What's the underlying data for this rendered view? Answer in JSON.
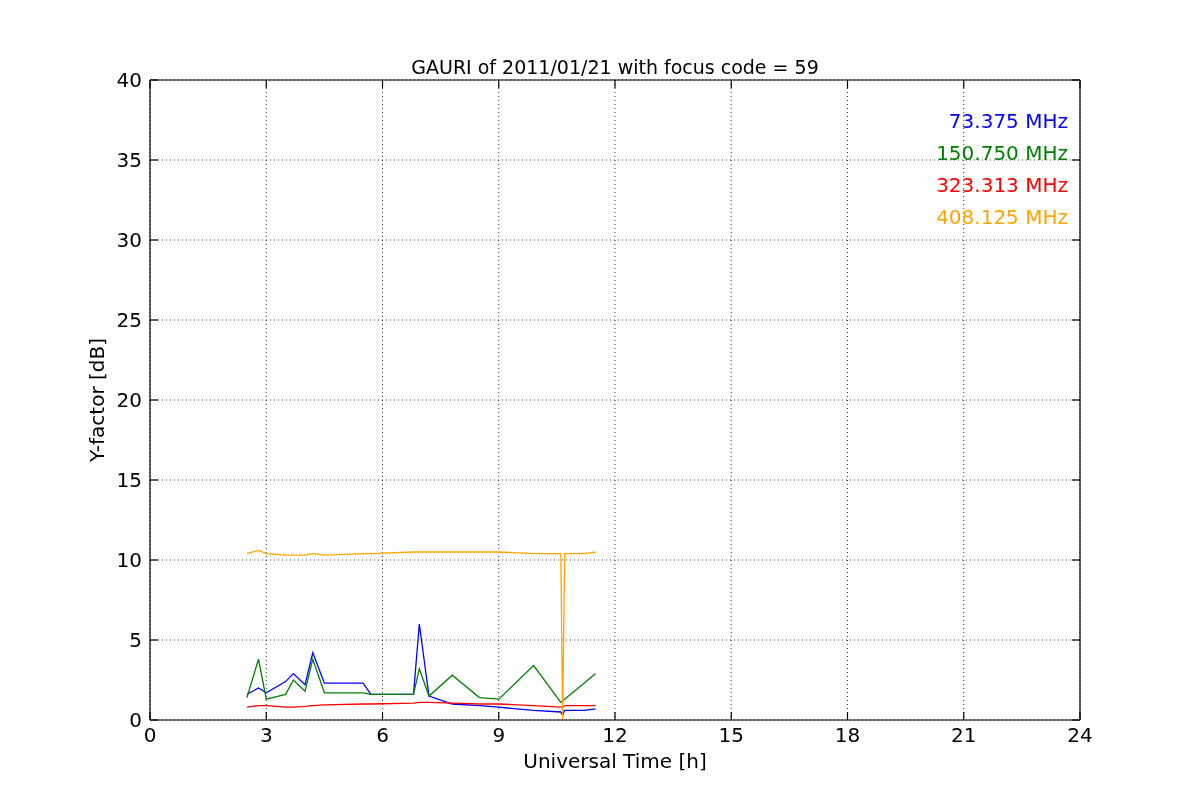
{
  "chart_data": {
    "type": "line",
    "title": "GAURI of 2011/01/21 with focus code = 59",
    "xlabel": "Universal Time [h]",
    "ylabel": "Y-factor [dB]",
    "x": [
      2.5,
      2.8,
      3,
      3.5,
      3.7,
      4,
      4.2,
      4.5,
      5.5,
      5.7,
      6.8,
      6.95,
      7.2,
      7.8,
      8.5,
      9,
      9.9,
      10.6,
      10.65,
      10.7,
      11.2,
      11.5
    ],
    "series": [
      {
        "name": "73.375 MHz",
        "color": "#0000ff",
        "values": [
          1.6,
          2.0,
          1.7,
          2.4,
          2.9,
          2.2,
          4.2,
          2.3,
          2.3,
          1.6,
          1.6,
          6.0,
          1.5,
          1.0,
          0.9,
          0.8,
          0.6,
          0.5,
          0.3,
          0.6,
          0.6,
          0.7
        ]
      },
      {
        "name": "150.750 MHz",
        "color": "#008000",
        "values": [
          1.4,
          3.8,
          1.3,
          1.6,
          2.5,
          1.8,
          3.8,
          1.7,
          1.7,
          1.6,
          1.6,
          3.2,
          1.5,
          2.8,
          1.4,
          1.3,
          3.4,
          1.1,
          1.2,
          1.3,
          2.3,
          2.9
        ]
      },
      {
        "name": "323.313 MHz",
        "color": "#ff0000",
        "values": [
          0.8,
          0.9,
          0.9,
          0.8,
          0.8,
          0.85,
          0.9,
          0.95,
          1.0,
          1.0,
          1.05,
          1.1,
          1.1,
          1.05,
          1.0,
          1.0,
          0.9,
          0.8,
          0.8,
          0.9,
          0.9,
          0.9
        ]
      },
      {
        "name": "408.125 MHz",
        "color": "#ffa500",
        "values": [
          10.4,
          10.6,
          10.4,
          10.3,
          10.3,
          10.3,
          10.4,
          10.3,
          10.4,
          10.4,
          10.5,
          10.5,
          10.5,
          10.5,
          10.5,
          10.5,
          10.4,
          10.4,
          0,
          10.4,
          10.4,
          10.5
        ]
      }
    ],
    "xlim": [
      0,
      24
    ],
    "ylim": [
      0,
      40
    ],
    "xticks": [
      0,
      3,
      6,
      9,
      12,
      15,
      18,
      21,
      24
    ],
    "yticks": [
      0,
      5,
      10,
      15,
      20,
      25,
      30,
      35,
      40
    ],
    "grid": true
  }
}
